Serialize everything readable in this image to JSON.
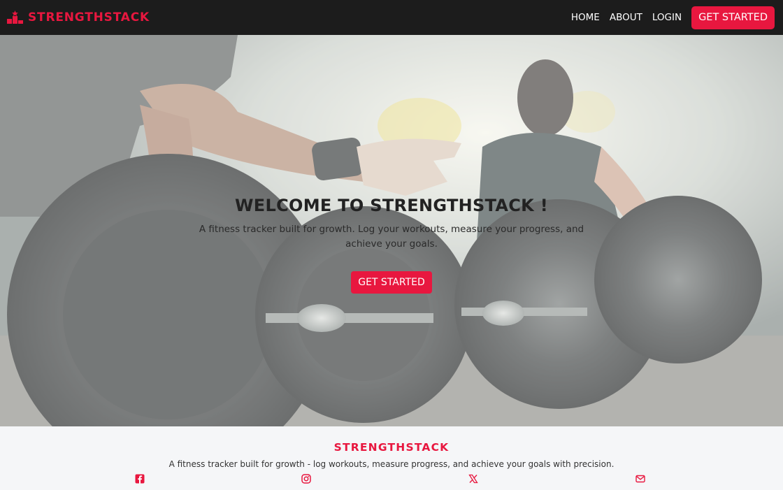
{
  "navbar": {
    "brand": "STRENGTHSTACK",
    "brand_icon": "podium-icon",
    "links": [
      "HOME",
      "ABOUT",
      "LOGIN"
    ],
    "cta": "GET STARTED"
  },
  "hero": {
    "title": "WELCOME TO STRENGTHSTACK !",
    "subtitle": "A fitness tracker built for growth. Log your workouts, measure your progress, and achieve your goals.",
    "cta": "GET STARTED"
  },
  "footer": {
    "brand": "STRENGTHSTACK",
    "description": "A fitness tracker built for growth - log workouts, measure progress, and achieve your goals with precision.",
    "social_icons": [
      "facebook-icon",
      "instagram-icon",
      "x-icon",
      "email-icon"
    ]
  },
  "colors": {
    "accent": "#e8173f",
    "navbar": "#1c1c1c",
    "footer": "#f5f6f8"
  }
}
